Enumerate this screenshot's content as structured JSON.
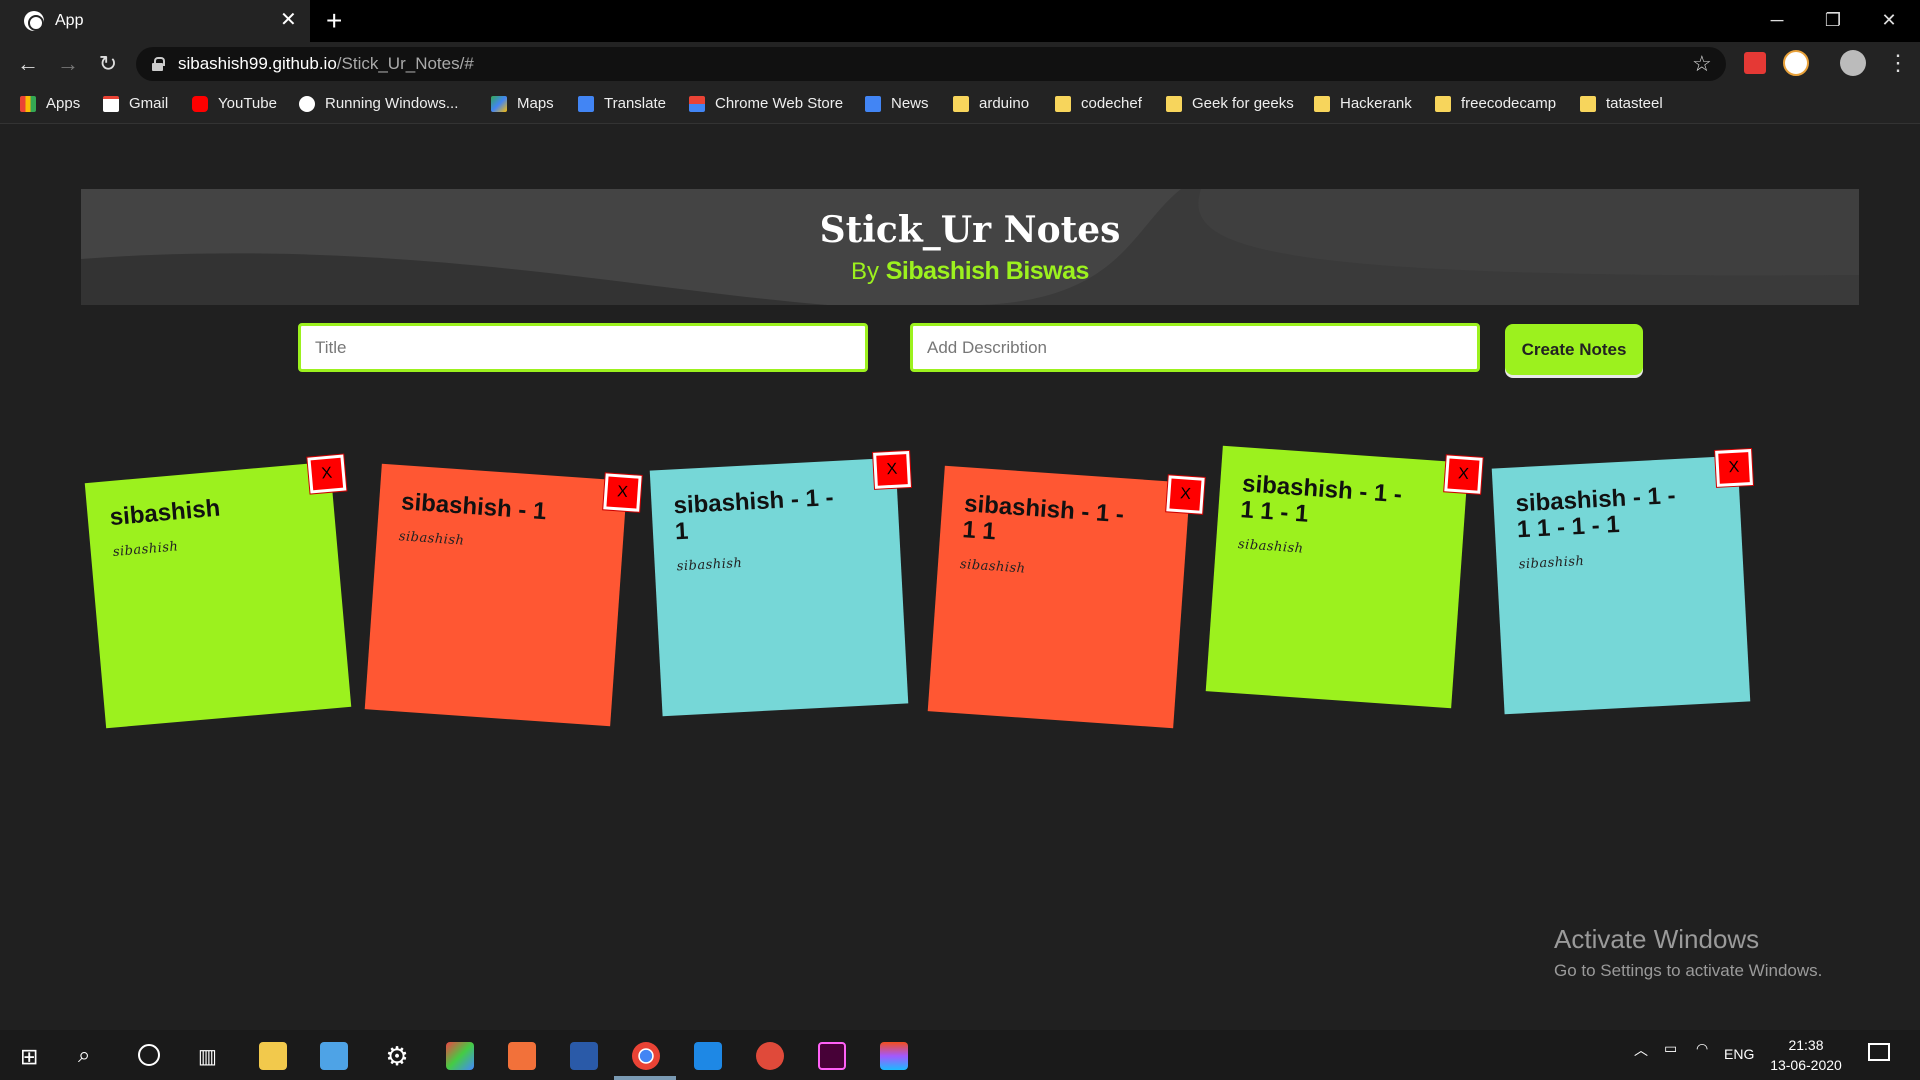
{
  "browser": {
    "tab_title": "App",
    "url_host": "sibashish99.github.io",
    "url_path": "/Stick_Ur_Notes/#"
  },
  "bookmarks": [
    "Apps",
    "Gmail",
    "YouTube",
    "Running Windows...",
    "Maps",
    "Translate",
    "Chrome Web Store",
    "News",
    "arduino",
    "codechef",
    "Geek for geeks",
    "Hackerank",
    "freecodecamp",
    "tatasteel"
  ],
  "header": {
    "title": "Stick_Ur Notes",
    "by_prefix": "By",
    "author": "Sibashish Biswas"
  },
  "form": {
    "title_placeholder": "Title",
    "description_placeholder": "Add Describtion",
    "create_label": "Create Notes"
  },
  "notes": [
    {
      "title": "sibashish",
      "description": "sibashish",
      "close": "X",
      "color": "#9cf11e"
    },
    {
      "title": "sibashish - 1",
      "description": "sibashish",
      "close": "X",
      "color": "#ff5733"
    },
    {
      "title": "sibashish - 1 - 1",
      "description": "sibashish",
      "close": "X",
      "color": "#76d7d7"
    },
    {
      "title": "sibashish - 1 - 1 1",
      "description": "sibashish",
      "close": "X",
      "color": "#ff5733"
    },
    {
      "title": "sibashish - 1 - 1 1 - 1",
      "description": "sibashish",
      "close": "X",
      "color": "#9cf11e"
    },
    {
      "title": "sibashish - 1 - 1 1 - 1 - 1",
      "description": "sibashish",
      "close": "X",
      "color": "#76d7d7"
    }
  ],
  "watermark": {
    "title": "Activate Windows",
    "subtitle": "Go to Settings to activate Windows."
  },
  "taskbar": {
    "lang": "ENG",
    "time": "21:38",
    "date": "13-06-2020"
  },
  "colors": {
    "accent": "#9cf11e",
    "note_orange": "#ff5733",
    "note_teal": "#76d7d7",
    "close_red": "#ff0000"
  }
}
